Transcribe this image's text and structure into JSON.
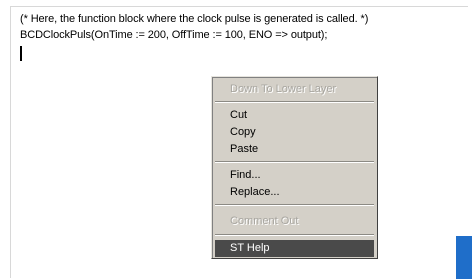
{
  "editor": {
    "lines": [
      "(* Here, the function block where the clock pulse is generated is called. *)",
      "BCDClockPuls(OnTime := 200, OffTime := 100, ENO => output);"
    ]
  },
  "context_menu": {
    "down_to_lower_layer": "Down To Lower Layer",
    "cut": "Cut",
    "copy": "Copy",
    "paste": "Paste",
    "find": "Find...",
    "replace": "Replace...",
    "comment_out": "Comment Out",
    "st_help": "ST Help"
  },
  "colors": {
    "menu_background": "#d4d0c8",
    "selected_item": "#4a4a4a",
    "disabled_text": "#a8a6a0",
    "accent_block": "#1f6ec9"
  }
}
